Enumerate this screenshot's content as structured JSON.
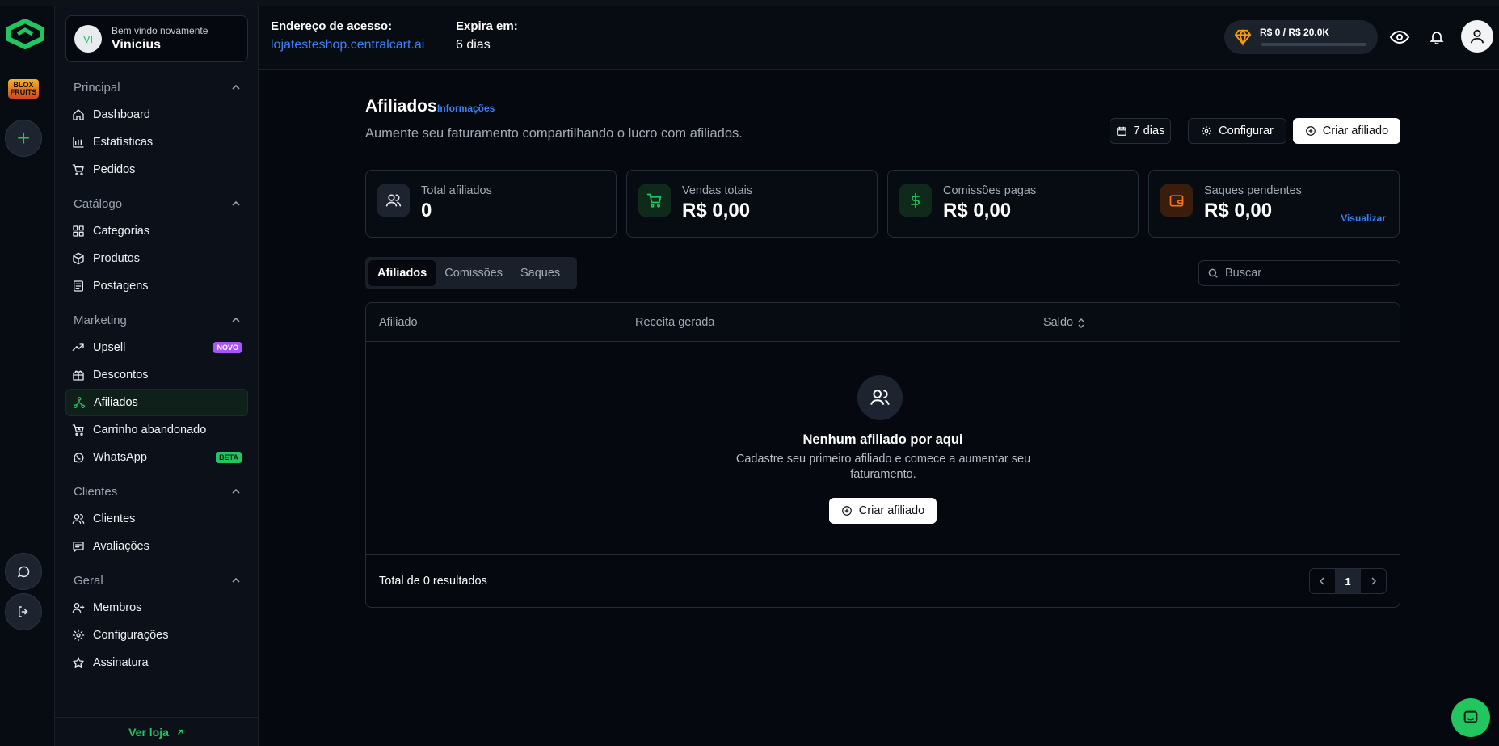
{
  "colors": {
    "accent": "#22c55e",
    "link": "#3b82f6",
    "background": "#05080f",
    "novo_badge": "#a855f7",
    "beta_badge": "#22c55e"
  },
  "rail": {
    "game_logo_text": "BLOX FRUITS",
    "icons": [
      "brand-logo-icon",
      "plus-icon",
      "chat-icon",
      "logout-icon"
    ]
  },
  "user": {
    "initials": "VI",
    "greeting": "Bem vindo novamente",
    "name": "Vinicius"
  },
  "sidebar": {
    "sections": [
      {
        "title": "Principal",
        "items": [
          {
            "label": "Dashboard",
            "icon": "home-icon"
          },
          {
            "label": "Estatísticas",
            "icon": "chart-icon"
          },
          {
            "label": "Pedidos",
            "icon": "cart-icon"
          }
        ]
      },
      {
        "title": "Catálogo",
        "items": [
          {
            "label": "Categorias",
            "icon": "grid-icon"
          },
          {
            "label": "Produtos",
            "icon": "box-icon"
          },
          {
            "label": "Postagens",
            "icon": "newspaper-icon"
          }
        ]
      },
      {
        "title": "Marketing",
        "items": [
          {
            "label": "Upsell",
            "icon": "trending-icon",
            "badge": "NOVO"
          },
          {
            "label": "Descontos",
            "icon": "gift-icon"
          },
          {
            "label": "Afiliados",
            "icon": "network-icon",
            "active": true
          },
          {
            "label": "Carrinho abandonado",
            "icon": "cart-x-icon"
          },
          {
            "label": "WhatsApp",
            "icon": "whatsapp-icon",
            "badge": "BETA"
          }
        ]
      },
      {
        "title": "Clientes",
        "items": [
          {
            "label": "Clientes",
            "icon": "users-icon"
          },
          {
            "label": "Avaliações",
            "icon": "message-icon"
          }
        ]
      },
      {
        "title": "Geral",
        "items": [
          {
            "label": "Membros",
            "icon": "user-plus-icon"
          },
          {
            "label": "Configurações",
            "icon": "gear-icon"
          },
          {
            "label": "Assinatura",
            "icon": "star-icon"
          }
        ]
      }
    ],
    "footer_label": "Ver loja"
  },
  "header": {
    "address_label": "Endereço de acesso:",
    "address_value": "lojatesteshop.centralcart.ai",
    "expires_label": "Expira em:",
    "expires_value": "6 dias",
    "plan_text": "R$ 0 / R$ 20.0K",
    "plan_progress": 0
  },
  "page": {
    "title": "Afiliados",
    "info_link": "Informações",
    "subtitle": "Aumente seu faturamento compartilhando o lucro com afiliados.",
    "buttons": {
      "period": "7 dias",
      "configure": "Configurar",
      "create": "Criar afiliado"
    }
  },
  "stats": [
    {
      "label": "Total afiliados",
      "value": "0",
      "icon": "users-icon"
    },
    {
      "label": "Vendas totais",
      "value": "R$ 0,00",
      "icon": "cart-icon"
    },
    {
      "label": "Comissões pagas",
      "value": "R$ 0,00",
      "icon": "dollar-icon"
    },
    {
      "label": "Saques pendentes",
      "value": "R$ 0,00",
      "icon": "wallet-icon",
      "action": "Visualizar"
    }
  ],
  "tabs": [
    "Afiliados",
    "Comissões",
    "Saques"
  ],
  "search": {
    "placeholder": "Buscar"
  },
  "table": {
    "columns": [
      "Afiliado",
      "Receita gerada",
      "Saldo"
    ],
    "empty_title": "Nenhum afiliado por aqui",
    "empty_desc": "Cadastre seu primeiro afiliado e comece a aumentar seu faturamento.",
    "empty_button": "Criar afiliado",
    "total_text": "Total de 0 resultados",
    "current_page": "1"
  }
}
